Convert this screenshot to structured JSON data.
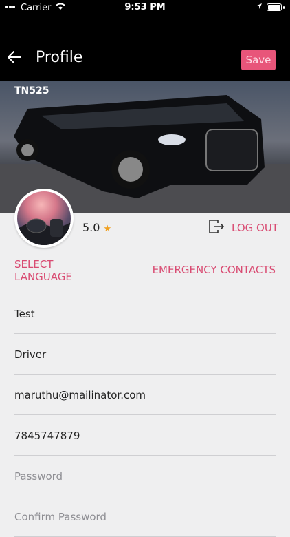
{
  "status_bar": {
    "carrier": "Carrier",
    "time": "9:53 PM"
  },
  "header": {
    "title": "Profile",
    "save_label": "Save"
  },
  "vehicle": {
    "plate": "TN525"
  },
  "profile": {
    "rating": "5.0",
    "logout_label": "LOG OUT"
  },
  "links": {
    "select_language": "SELECT LANGUAGE",
    "emergency_contacts": "EMERGENCY CONTACTS"
  },
  "form": {
    "first_name": "Test",
    "last_name": "Driver",
    "email": "maruthu@mailinator.com",
    "phone": "7845747879",
    "password_placeholder": "Password",
    "confirm_password_placeholder": "Confirm Password"
  },
  "colors": {
    "accent": "#d94b72",
    "save_button": "#e8557a",
    "header_bg": "#000000",
    "page_bg": "#efeff0"
  },
  "icons": {
    "back": "arrow-left-icon",
    "logout": "logout-icon",
    "star": "star-icon"
  }
}
